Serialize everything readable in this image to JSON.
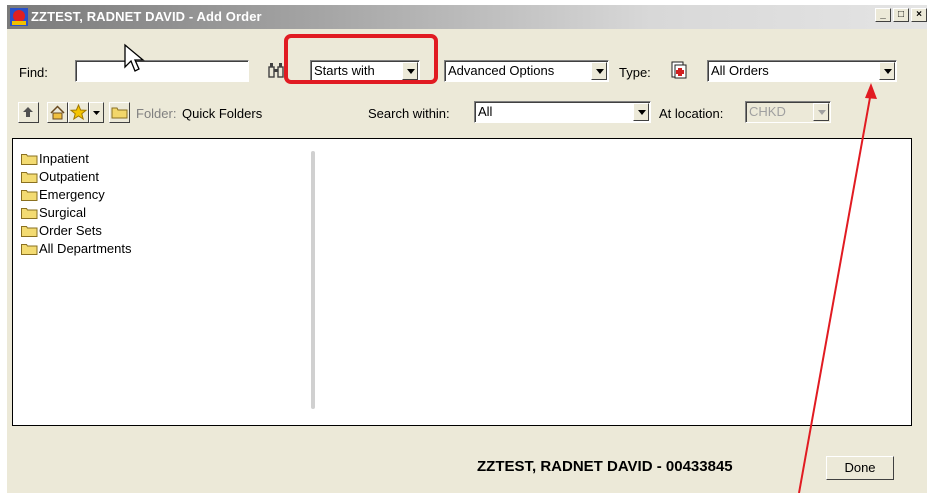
{
  "window": {
    "title": "ZZTEST, RADNET DAVID - Add Order",
    "minimize": "_",
    "maximize": "□",
    "close": "×"
  },
  "toolbar": {
    "find_label": "Find:",
    "find_value": "",
    "match_mode": "Starts with",
    "advanced": "Advanced Options",
    "type_label": "Type:",
    "type_value": "All Orders",
    "folder_label": "Folder:",
    "folder_value": "Quick Folders",
    "search_within_label": "Search within:",
    "search_within_value": "All",
    "location_label": "At location:",
    "location_value": "CHKD"
  },
  "tree": {
    "items": [
      {
        "label": "Inpatient"
      },
      {
        "label": "Outpatient"
      },
      {
        "label": "Emergency"
      },
      {
        "label": "Surgical"
      },
      {
        "label": "Order Sets"
      },
      {
        "label": "All Departments"
      }
    ]
  },
  "status": {
    "patient": "ZZTEST, RADNET DAVID - 00433845",
    "done_label": "Done"
  },
  "annotation": {
    "color": "#e11b22"
  }
}
